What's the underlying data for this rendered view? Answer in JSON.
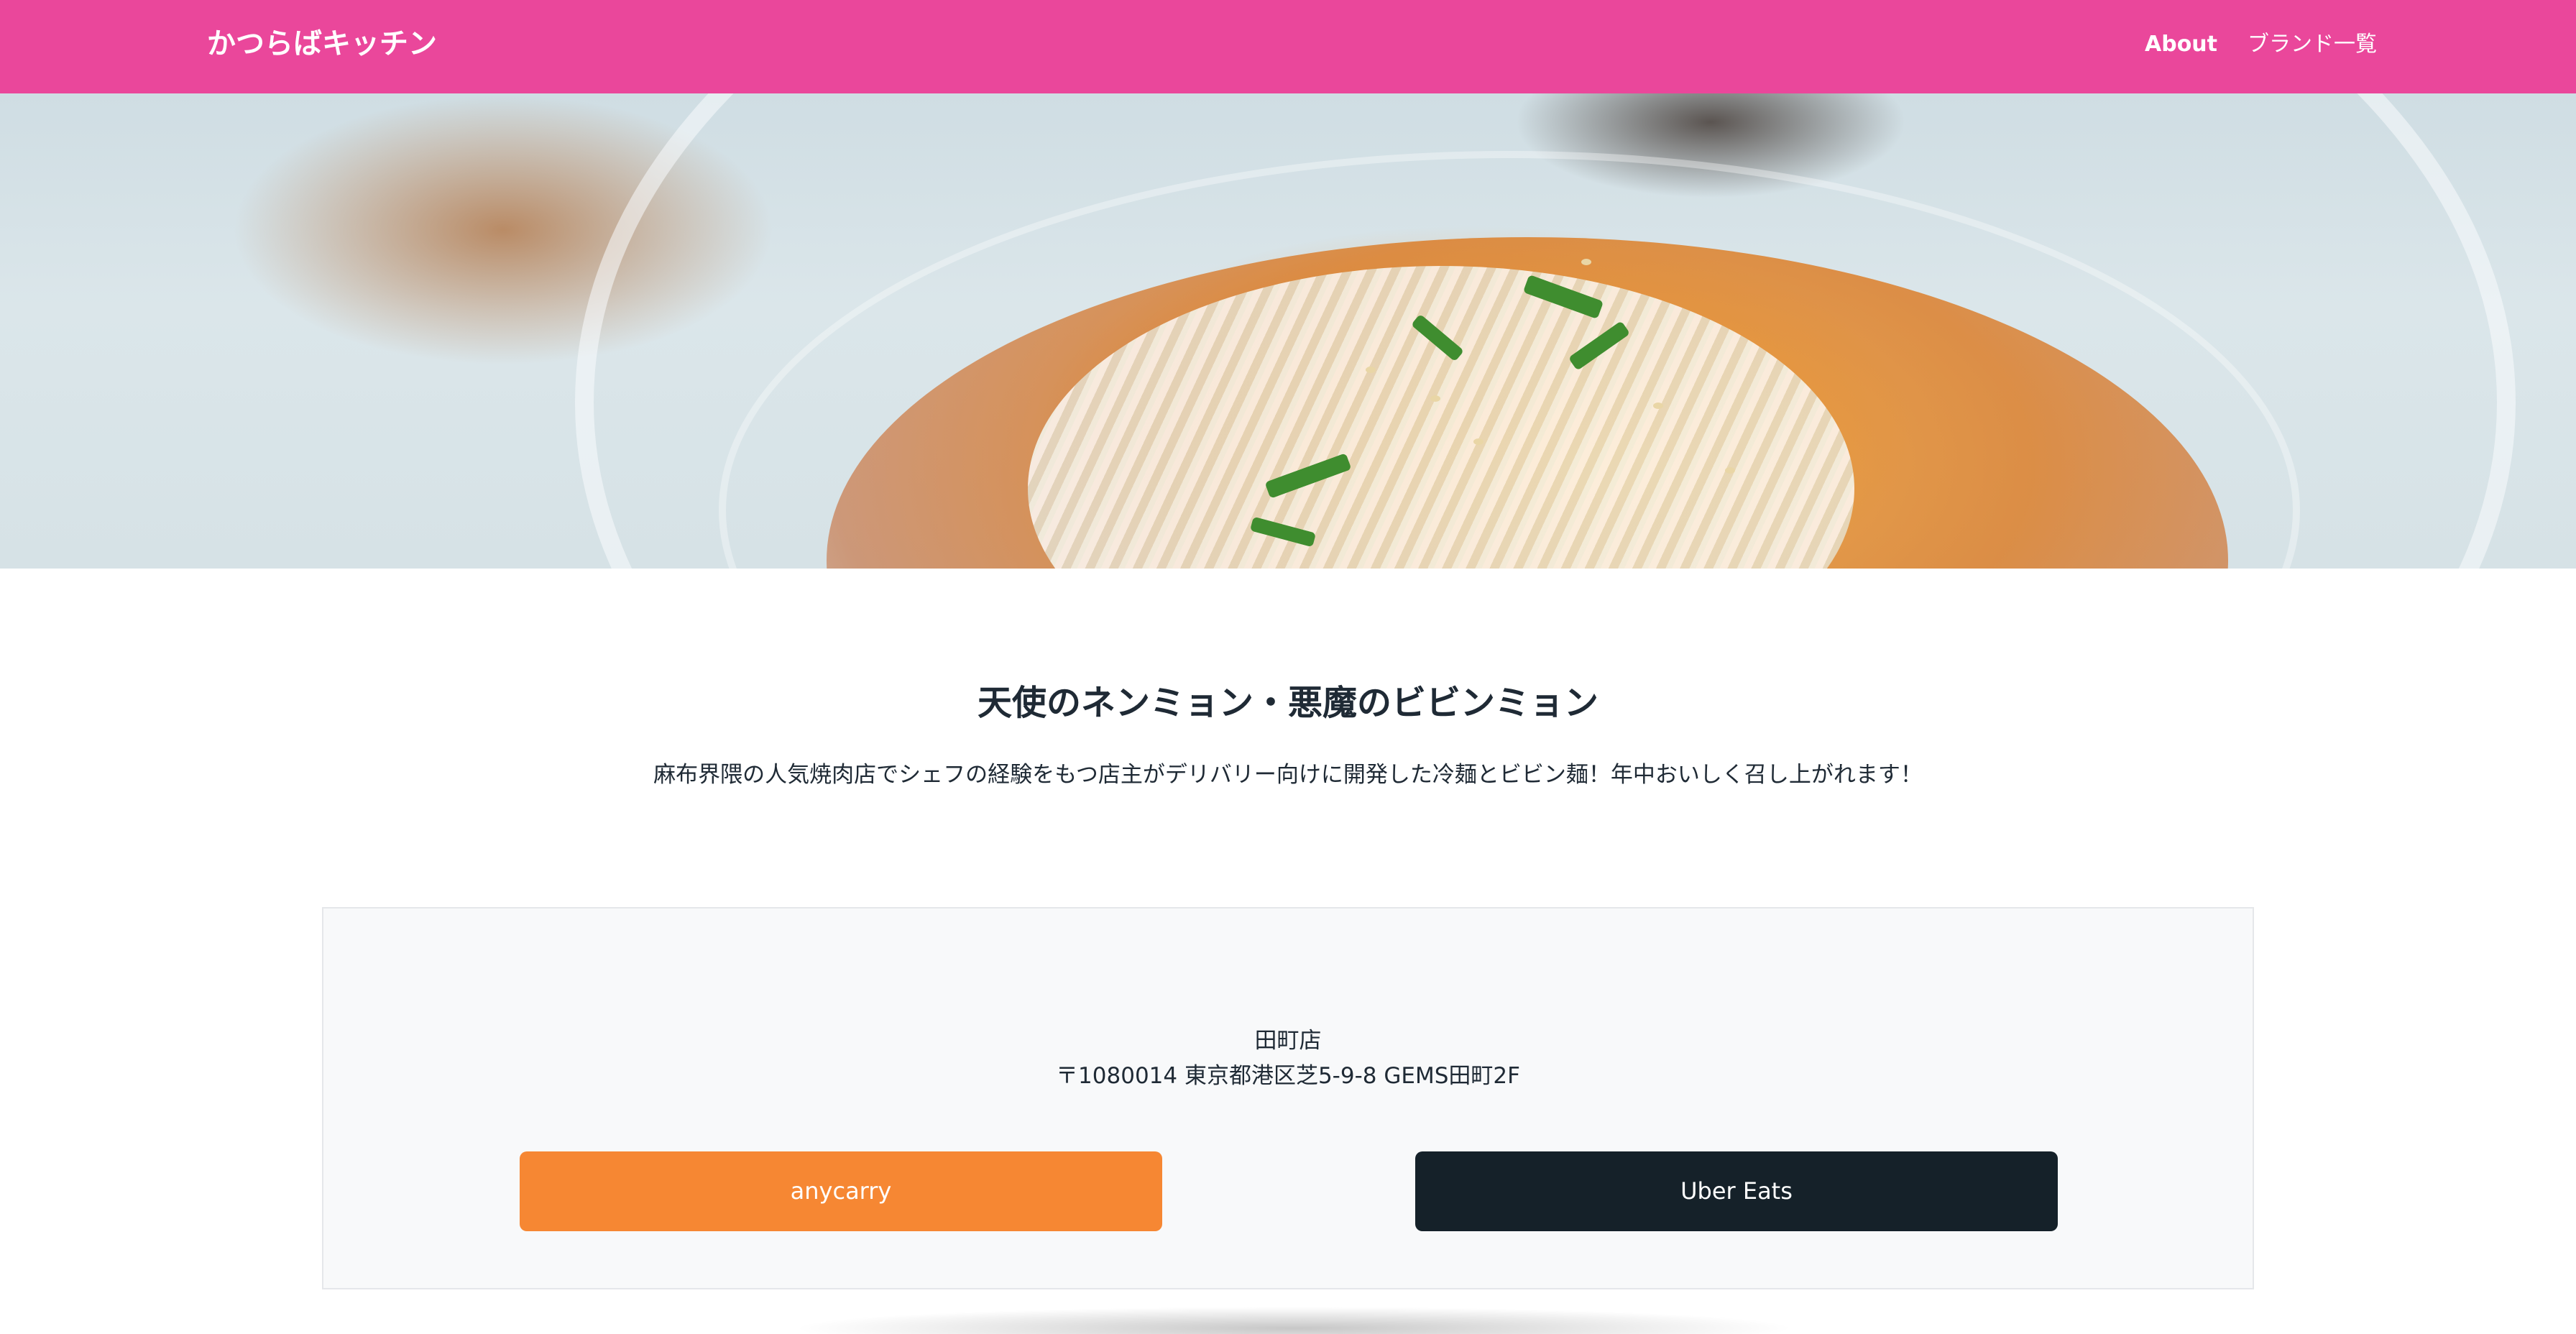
{
  "navbar": {
    "brand": "かつらばキッチン",
    "links": [
      {
        "label": "About"
      },
      {
        "label": "ブランド一覧"
      }
    ],
    "bg_color": "#ea479b"
  },
  "hero": {
    "image": "noodle-bowl-photo"
  },
  "main": {
    "title": "天使のネンミョン・悪魔のビビンミョン",
    "description": "麻布界隈の人気焼肉店でシェフの経験をもつ店主がデリバリー向けに開発した冷麺とビビン麺！年中おいしく召し上がれます！"
  },
  "store": {
    "name": "田町店",
    "address": "〒1080014 東京都港区芝5-9-8 GEMS田町2F",
    "buttons": [
      {
        "label": "anycarry",
        "color": "#f68733"
      },
      {
        "label": "Uber Eats",
        "color": "#152129"
      }
    ]
  }
}
